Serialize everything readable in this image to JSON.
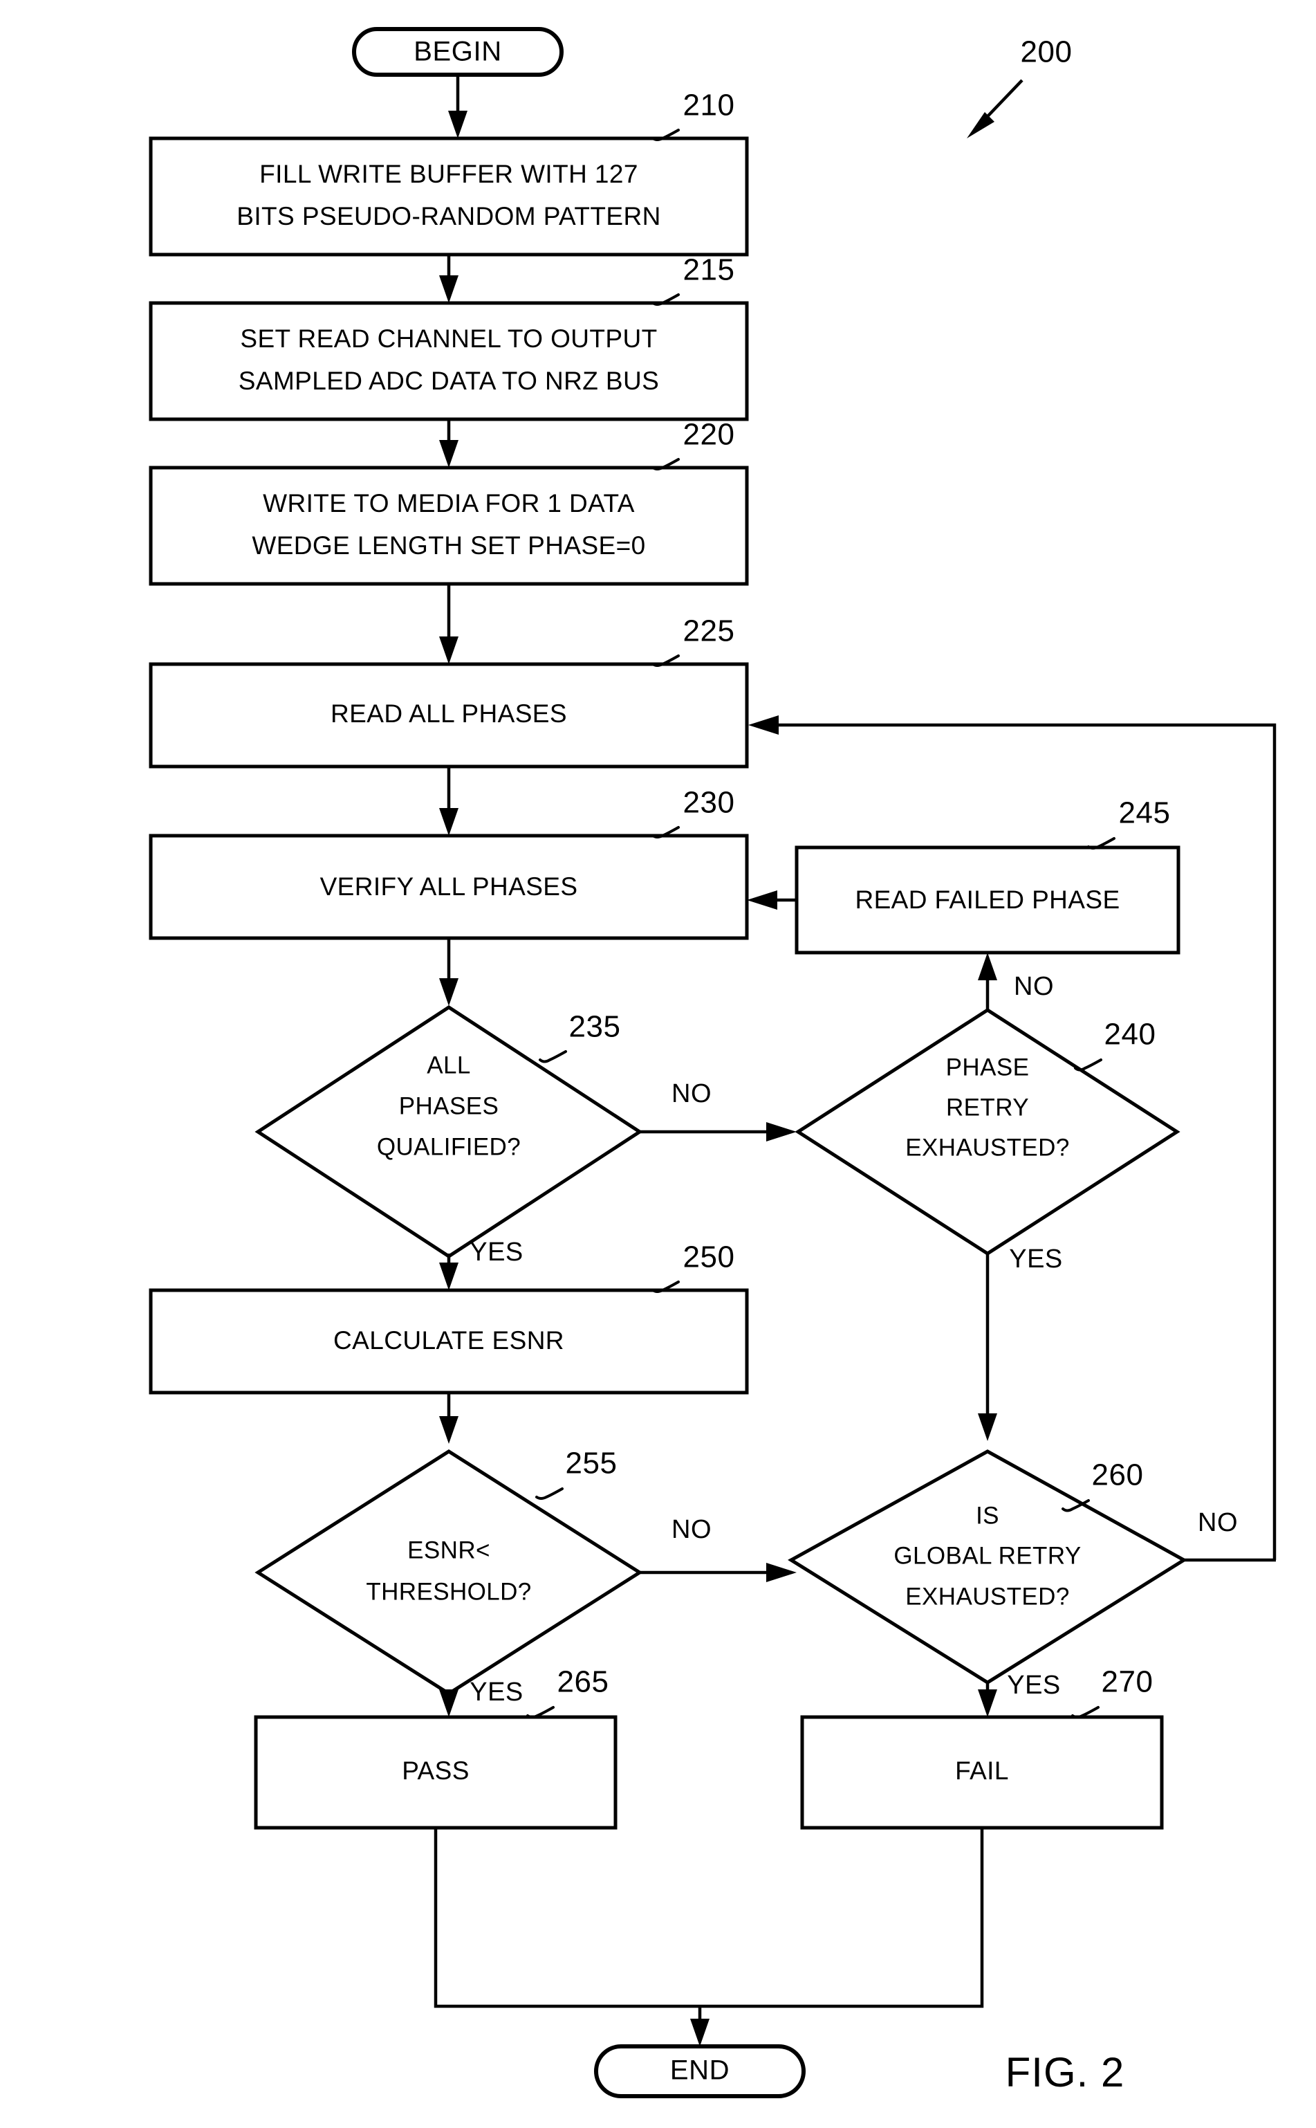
{
  "figure": {
    "label": "FIG. 2",
    "diagram_ref": "200"
  },
  "terminals": {
    "begin": "BEGIN",
    "end": "END"
  },
  "process_steps": [
    {
      "ref": "210",
      "lines": [
        "FILL WRITE BUFFER WITH 127",
        "BITS PSEUDO-RANDOM PATTERN"
      ]
    },
    {
      "ref": "215",
      "lines": [
        "SET READ CHANNEL TO OUTPUT",
        "SAMPLED ADC DATA TO NRZ BUS"
      ]
    },
    {
      "ref": "220",
      "lines": [
        "WRITE TO MEDIA FOR 1 DATA",
        "WEDGE LENGTH SET PHASE=0"
      ]
    },
    {
      "ref": "225",
      "lines": [
        "READ ALL PHASES"
      ]
    },
    {
      "ref": "230",
      "lines": [
        "VERIFY ALL PHASES"
      ]
    },
    {
      "ref": "245",
      "lines": [
        "READ FAILED PHASE"
      ]
    },
    {
      "ref": "250",
      "lines": [
        "CALCULATE ESNR"
      ]
    },
    {
      "ref": "265",
      "lines": [
        "PASS"
      ]
    },
    {
      "ref": "270",
      "lines": [
        "FAIL"
      ]
    }
  ],
  "decisions": [
    {
      "ref": "235",
      "lines": [
        "ALL",
        "PHASES",
        "QUALIFIED?"
      ],
      "branch_no": "NO",
      "branch_yes": "YES"
    },
    {
      "ref": "240",
      "lines": [
        "PHASE",
        "RETRY",
        "EXHAUSTED?"
      ],
      "branch_no": "NO",
      "branch_yes": "YES"
    },
    {
      "ref": "255",
      "lines": [
        "ESNR<",
        "THRESHOLD?"
      ],
      "branch_no": "NO",
      "branch_yes": "YES"
    },
    {
      "ref": "260",
      "lines": [
        "IS",
        "GLOBAL RETRY",
        "EXHAUSTED?"
      ],
      "branch_no": "NO",
      "branch_yes": "YES"
    }
  ],
  "colors": {
    "ink": "#000000",
    "paper": "#ffffff"
  },
  "chart_data": {
    "type": "flowchart",
    "title": "FIG. 2",
    "nodes": [
      {
        "id": "begin",
        "type": "terminal",
        "label": "BEGIN"
      },
      {
        "id": "210",
        "type": "process",
        "label": "FILL WRITE BUFFER WITH 127 BITS PSEUDO-RANDOM PATTERN"
      },
      {
        "id": "215",
        "type": "process",
        "label": "SET READ CHANNEL TO OUTPUT SAMPLED ADC DATA TO NRZ BUS"
      },
      {
        "id": "220",
        "type": "process",
        "label": "WRITE TO MEDIA FOR 1 DATA WEDGE LENGTH SET PHASE=0"
      },
      {
        "id": "225",
        "type": "process",
        "label": "READ ALL PHASES"
      },
      {
        "id": "230",
        "type": "process",
        "label": "VERIFY ALL PHASES"
      },
      {
        "id": "235",
        "type": "decision",
        "label": "ALL PHASES QUALIFIED?"
      },
      {
        "id": "240",
        "type": "decision",
        "label": "PHASE RETRY EXHAUSTED?"
      },
      {
        "id": "245",
        "type": "process",
        "label": "READ FAILED PHASE"
      },
      {
        "id": "250",
        "type": "process",
        "label": "CALCULATE ESNR"
      },
      {
        "id": "255",
        "type": "decision",
        "label": "ESNR< THRESHOLD?"
      },
      {
        "id": "260",
        "type": "decision",
        "label": "IS GLOBAL RETRY EXHAUSTED?"
      },
      {
        "id": "265",
        "type": "process",
        "label": "PASS"
      },
      {
        "id": "270",
        "type": "process",
        "label": "FAIL"
      },
      {
        "id": "end",
        "type": "terminal",
        "label": "END"
      }
    ],
    "edges": [
      {
        "from": "begin",
        "to": "210",
        "label": ""
      },
      {
        "from": "210",
        "to": "215",
        "label": ""
      },
      {
        "from": "215",
        "to": "220",
        "label": ""
      },
      {
        "from": "220",
        "to": "225",
        "label": ""
      },
      {
        "from": "225",
        "to": "230",
        "label": ""
      },
      {
        "from": "230",
        "to": "235",
        "label": ""
      },
      {
        "from": "235",
        "to": "240",
        "label": "NO"
      },
      {
        "from": "235",
        "to": "250",
        "label": "YES"
      },
      {
        "from": "240",
        "to": "245",
        "label": "NO"
      },
      {
        "from": "240",
        "to": "260",
        "label": "YES"
      },
      {
        "from": "245",
        "to": "230",
        "label": ""
      },
      {
        "from": "250",
        "to": "255",
        "label": ""
      },
      {
        "from": "255",
        "to": "265",
        "label": "YES"
      },
      {
        "from": "255",
        "to": "260",
        "label": "NO"
      },
      {
        "from": "260",
        "to": "270",
        "label": "YES"
      },
      {
        "from": "260",
        "to": "225",
        "label": "NO"
      },
      {
        "from": "265",
        "to": "end",
        "label": ""
      },
      {
        "from": "270",
        "to": "end",
        "label": ""
      }
    ]
  }
}
